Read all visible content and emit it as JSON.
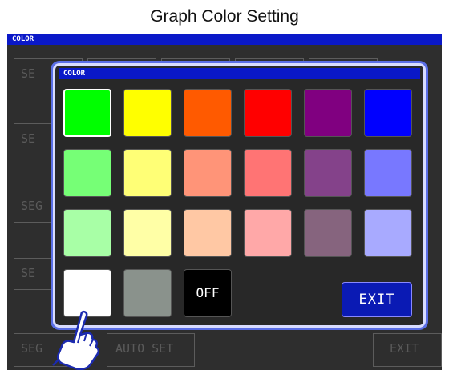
{
  "caption": "Graph Color Setting",
  "screen": {
    "title": "COLOR",
    "background_buttons": {
      "seg_short": "SE",
      "seg_mid": "SEG",
      "seg_full": "SEG",
      "auto_set": "AUTO SET",
      "exit": "EXIT"
    }
  },
  "dialog": {
    "title": "COLOR",
    "swatches": [
      {
        "color": "#00ff00"
      },
      {
        "color": "#ffff00"
      },
      {
        "color": "#ff5a00"
      },
      {
        "color": "#ff0000"
      },
      {
        "color": "#800080"
      },
      {
        "color": "#0000ff"
      },
      {
        "color": "#76ff76"
      },
      {
        "color": "#ffff76"
      },
      {
        "color": "#ff9478"
      },
      {
        "color": "#ff7474"
      },
      {
        "color": "#84428a"
      },
      {
        "color": "#7878ff"
      },
      {
        "color": "#a8ffa6"
      },
      {
        "color": "#ffffa6"
      },
      {
        "color": "#ffc8a4"
      },
      {
        "color": "#ffa8a8"
      },
      {
        "color": "#86647e"
      },
      {
        "color": "#a8aaff"
      },
      {
        "color": "#ffffff"
      },
      {
        "color": "#8a928c"
      }
    ],
    "selected_color": "#00ff00",
    "off_label": "OFF",
    "exit_label": "EXIT"
  },
  "icons": {
    "pointer": "pointing-hand-icon"
  }
}
